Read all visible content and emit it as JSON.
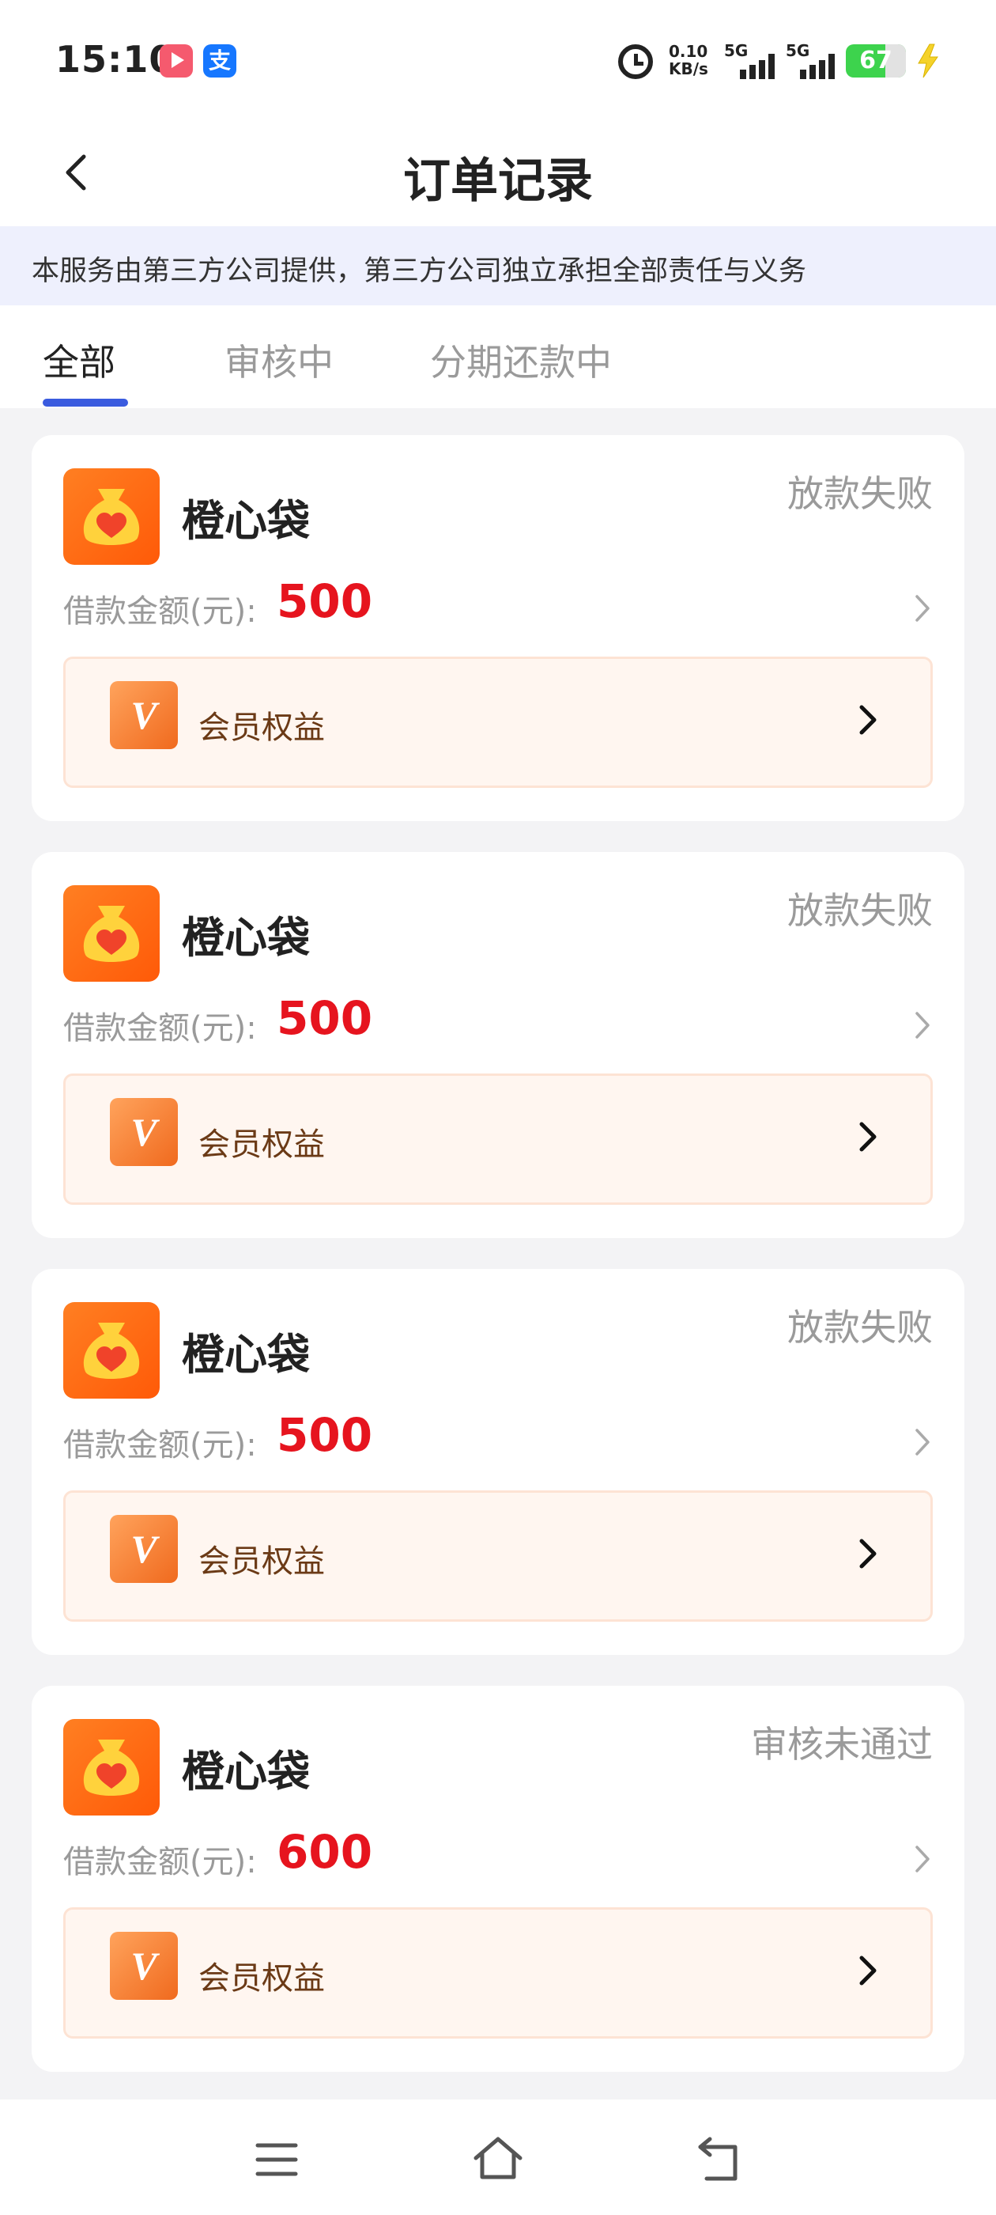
{
  "status_bar": {
    "time": "15:10",
    "app_icons": [
      "video-app-icon",
      "alipay-icon"
    ],
    "alipay_glyph": "支",
    "speed_value": "0.10",
    "speed_unit": "KB/s",
    "network_1": "5G",
    "network_2": "5G",
    "battery": "67"
  },
  "header": {
    "title": "订单记录",
    "back_icon": "chevron-left-icon"
  },
  "notice": {
    "text": "本服务由第三方公司提供，第三方公司独立承担全部责任与义务"
  },
  "tabs": [
    {
      "label": "全部",
      "active": true
    },
    {
      "label": "审核中",
      "active": false
    },
    {
      "label": "分期还款中",
      "active": false
    }
  ],
  "orders": [
    {
      "name": "橙心袋",
      "status": "放款失败",
      "amount_label": "借款金额(元):",
      "amount": "500",
      "benefit_label": "会员权益",
      "vip_badge": "V"
    },
    {
      "name": "橙心袋",
      "status": "放款失败",
      "amount_label": "借款金额(元):",
      "amount": "500",
      "benefit_label": "会员权益",
      "vip_badge": "V"
    },
    {
      "name": "橙心袋",
      "status": "放款失败",
      "amount_label": "借款金额(元):",
      "amount": "500",
      "benefit_label": "会员权益",
      "vip_badge": "V"
    },
    {
      "name": "橙心袋",
      "status": "审核未通过",
      "amount_label": "借款金额(元):",
      "amount": "600",
      "benefit_label": "会员权益",
      "vip_badge": "V"
    }
  ],
  "system_nav": [
    "menu-icon",
    "home-icon",
    "back-icon"
  ],
  "colors": {
    "accent": "#3a5bdf",
    "amount": "#e6141e",
    "logo": "#ff6a12",
    "notice_bg": "#eef0fd",
    "vip_bg": "#fff6f0"
  }
}
